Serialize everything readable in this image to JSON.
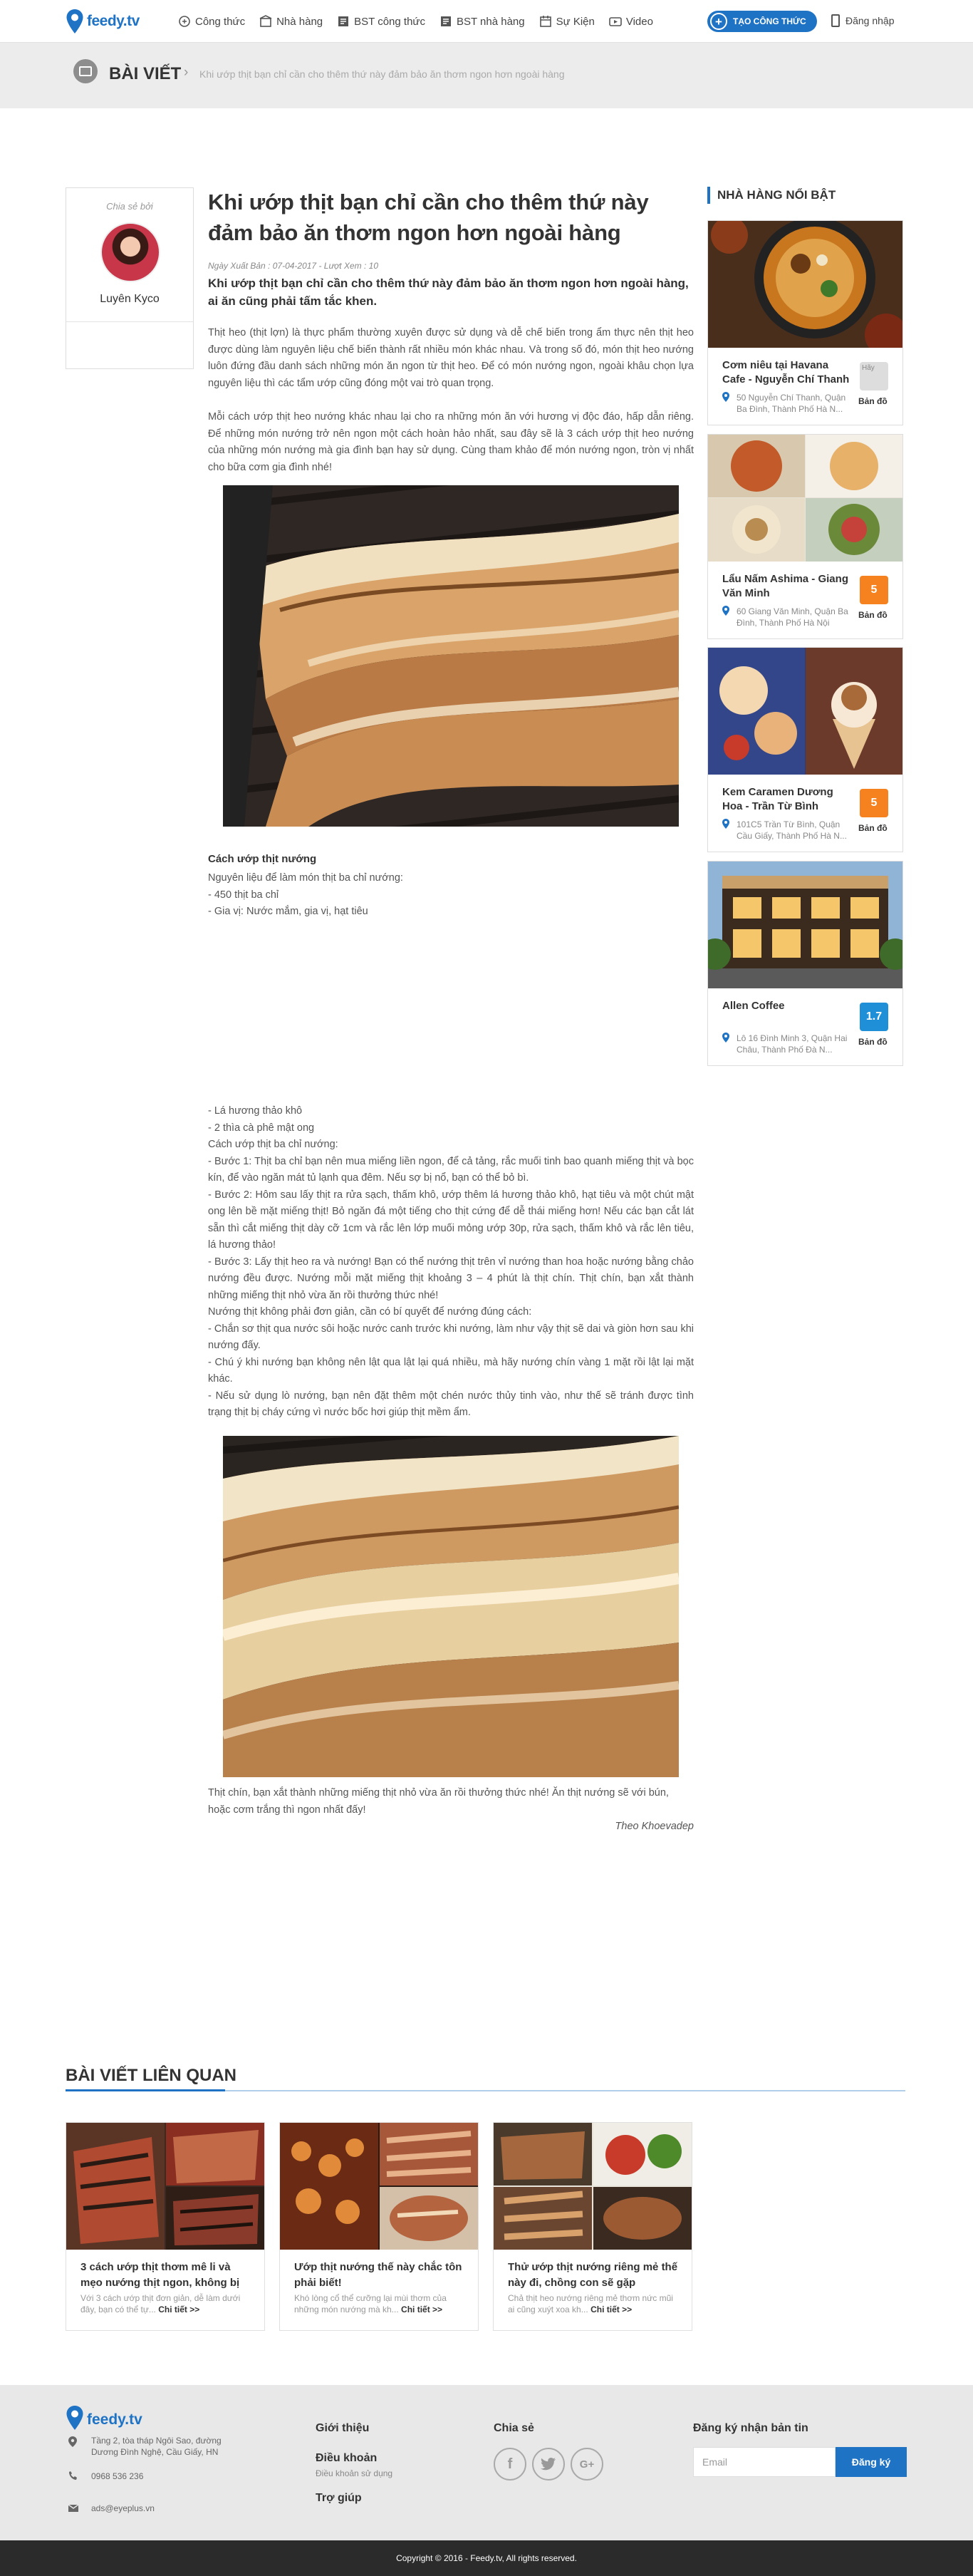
{
  "header": {
    "logo_text": "feedy.tv",
    "nav": [
      {
        "label": "Công thức",
        "icon": "recipe-icon"
      },
      {
        "label": "Nhà hàng",
        "icon": "restaurant-icon"
      },
      {
        "label": "BST công thức",
        "icon": "collection-icon"
      },
      {
        "label": "BST nhà hàng",
        "icon": "collection-icon"
      },
      {
        "label": "Sự Kiện",
        "icon": "calendar-icon"
      },
      {
        "label": "Video",
        "icon": "video-icon"
      }
    ],
    "create_label": "TẠO CÔNG THỨC",
    "login_label": "Đăng nhập"
  },
  "breadcrumb": {
    "section": "BÀI VIẾT",
    "current": "Khi ướp thịt bạn chỉ cần cho thêm thứ này đảm bảo ăn thơm ngon hơn ngoài hàng"
  },
  "author": {
    "shared_by_label": "Chia sẻ bởi",
    "name": "Luyên Kyco"
  },
  "article": {
    "title": "Khi ướp thịt bạn chỉ cần cho thêm thứ này đảm bảo ăn thơm ngon hơn ngoài hàng",
    "meta": "Ngày Xuất Bản : 07-04-2017 - Lượt Xem : 10",
    "lead": "Khi ướp thịt bạn chỉ cần cho thêm thứ này đảm bảo ăn thơm ngon hơn ngoài hàng, ai ăn cũng phải tấm tắc khen.",
    "para1": "Thịt heo (thịt lợn) là thực phẩm thường xuyên được sử dụng và dễ chế biến trong ẩm thực nên thịt heo được dùng làm nguyên liệu chế biến thành rất nhiều món khác nhau. Và trong số đó, món thịt heo nướng luôn đứng đầu danh sách những món ăn ngon từ thịt heo. Để có món nướng ngon, ngoài khâu chọn lựa nguyên liệu thì các tẩm ướp cũng đóng một vai trò quan trọng.",
    "para2": "Mỗi cách ướp thịt heo nướng khác nhau lại cho ra những món ăn với hương vị độc đáo, hấp dẫn riêng. Để những món nướng trở nên ngon một cách hoàn hảo nhất, sau đây sẽ là 3 cách ướp thịt heo nướng của những món nướng mà gia đình bạn hay sử dụng. Cùng tham khảo để món nướng ngon, tròn vị nhất cho bữa cơm gia đình nhé!",
    "subheading": "Cách ướp thịt nướng",
    "ingredients_intro": [
      "Nguyên liệu để làm món thịt ba chỉ nướng:",
      "- 450 thịt ba chỉ",
      "- Gia vị: Nước mắm, gia vị, hạt tiêu"
    ],
    "steps": [
      "- Lá hương thảo khô",
      "- 2 thìa cà phê mật ong",
      "Cách ướp thịt ba chỉ nướng:",
      "- Bước 1: Thịt ba chỉ bạn nên mua miếng liền ngon, để cả tảng, rắc muối tinh bao quanh miếng thịt và bọc kín, để vào ngăn mát tủ lạnh qua đêm. Nếu sợ bị nổ, bạn có thể bỏ bì.",
      "- Bước 2: Hôm sau lấy thịt ra rửa sạch, thấm khô, ướp thêm lá hương thảo khô, hạt tiêu và một chút mật ong lên bề mặt miếng thịt! Bỏ ngăn đá một tiếng cho thịt cứng để dễ thái miếng hơn! Nếu các bạn cắt lát sẵn thì cắt miếng thịt dày cỡ 1cm và rắc lên lớp muối mỏng ướp 30p, rửa sạch, thấm khô và rắc lên tiêu, lá hương thảo!",
      "- Bước 3: Lấy thịt heo ra và nướng! Bạn có thể nướng thịt trên vỉ nướng than hoa hoặc nướng bằng chảo nướng đều được. Nướng mỗi mặt miếng thịt khoảng 3 – 4 phút là thịt chín. Thịt chín, bạn xắt thành những miếng thịt nhỏ vừa ăn rồi thưởng thức nhé!",
      "Nướng thịt không phải đơn giản, cần có bí quyết để nướng đúng cách:",
      "- Chắn sơ thịt qua nước sôi hoặc nước canh trước khi nướng, làm như vậy thịt sẽ dai và giòn hơn sau khi nướng đấy.",
      "- Chú ý khi nướng bạn không nên lật qua lật lại quá nhiều, mà hãy nướng chín vàng 1 mặt rồi lật lại mặt khác.",
      "- Nếu sử dụng lò nướng, bạn nên đặt thêm một chén nước thủy tinh vào, như thế sẽ tránh được tình trạng thịt bị cháy cứng vì nước bốc hơi giúp thịt mềm ẩm."
    ],
    "caption": "Thịt chín, bạn xắt thành những miếng thịt nhỏ vừa ăn rồi thưởng thức nhé! Ăn thịt nướng sẽ với bún, hoặc cơm trắng thì ngon nhất đấy!",
    "source": "Theo Khoevadep"
  },
  "sidebar": {
    "heading": "NHÀ HÀNG NỔI BẬT",
    "map_label": "Bản đồ",
    "restaurants": [
      {
        "name": "Cơm niêu tại Havana Cafe - Nguyễn Chí Thanh",
        "address": "50 Nguyễn Chí Thanh, Quận Ba Đình, Thành Phố Hà N...",
        "score": "",
        "broken_img_alt": "Hãy"
      },
      {
        "name": "Lẩu Nấm Ashima - Giang Văn Minh",
        "address": "60 Giang Văn Minh, Quận Ba Đình, Thành Phố Hà Nội",
        "score": "5"
      },
      {
        "name": "Kem Caramen Dương Hoa - Trần Từ Bình",
        "address": "101C5 Trần Từ Bình, Quận Cầu Giấy, Thành Phố Hà N...",
        "score": "5"
      },
      {
        "name": "Allen Coffee",
        "address": "Lô 16 Đình Minh 3, Quận Hai Châu, Thành Phố Đà N...",
        "score": "1.7"
      }
    ],
    "colors": {
      "score_orange": "#f5821f",
      "score_blue": "#1f8fd8"
    }
  },
  "related": {
    "heading": "BÀI VIẾT LIÊN QUAN",
    "more_label": "Chi tiết >>",
    "items": [
      {
        "title": "3 cách ướp thịt thơm mê li và mẹo nướng thịt ngon, không bị",
        "desc": "Với 3 cách ướp thịt đơn giản, dễ làm dưới đây, bạn có thể tự..."
      },
      {
        "title": "Ướp thịt nướng thế này chắc tôn phải biết!",
        "desc": "Khó lòng cổ thể cưỡng lại mùi thơm của những món nướng mà kh..."
      },
      {
        "title": "Thử ướp thịt nướng riêng mẻ thế này đi, chồng con sẽ gặp",
        "desc": "Chả thịt heo nướng riêng mẻ thơm nức mũi ai cũng xuýt xoa kh..."
      }
    ]
  },
  "footer": {
    "logo_text": "feedy.tv",
    "address": "Tầng 2, tòa tháp Ngôi Sao, đường Dương Đình Nghệ, Cầu Giấy, HN",
    "phone": "0968 536 236",
    "email": "ads@eyeplus.vn",
    "links": [
      "Giới thiệu",
      "Điều khoản",
      "Trợ giúp"
    ],
    "terms_sub": "Điều khoản sử dụng",
    "share_label": "Chia sẻ",
    "newsletter_label": "Đăng ký nhận bản tin",
    "email_placeholder": "Email",
    "subscribe_label": "Đăng ký",
    "copyright": "Copyright © 2016 - Feedy.tv, All rights reserved.",
    "brand_color": "#1f73c5"
  }
}
